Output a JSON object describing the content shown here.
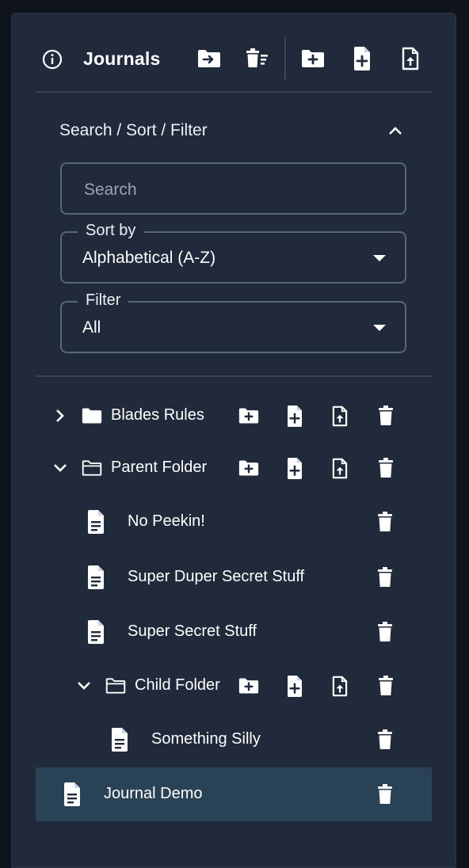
{
  "header": {
    "title": "Journals",
    "icons": [
      "info-icon",
      "folder-move-icon",
      "delete-sort-icon",
      "add-folder-icon",
      "add-file-icon",
      "upload-file-icon"
    ]
  },
  "search_section": {
    "title": "Search / Sort / Filter",
    "search_placeholder": "Search",
    "search_value": "",
    "sort_label": "Sort by",
    "sort_value": "Alphabetical (A-Z)",
    "filter_label": "Filter",
    "filter_value": "All"
  },
  "tree": [
    {
      "label": "Blades Rules",
      "type": "folder",
      "expanded": false,
      "depth": 0
    },
    {
      "label": "Parent Folder",
      "type": "folder",
      "expanded": true,
      "depth": 0
    },
    {
      "label": "No Peekin!",
      "type": "file",
      "depth": 1
    },
    {
      "label": "Super Duper Secret Stuff",
      "type": "file",
      "depth": 1
    },
    {
      "label": "Super Secret Stuff",
      "type": "file",
      "depth": 1
    },
    {
      "label": "Child Folder",
      "type": "folder",
      "expanded": true,
      "depth": 1
    },
    {
      "label": "Something Silly",
      "type": "file",
      "depth": 2
    },
    {
      "label": "Journal Demo",
      "type": "file",
      "depth": 0,
      "selected": true
    }
  ],
  "colors": {
    "background": "#0f141c",
    "panel": "#202a3b",
    "selected_row": "#2a4255",
    "border": "#59667a"
  }
}
